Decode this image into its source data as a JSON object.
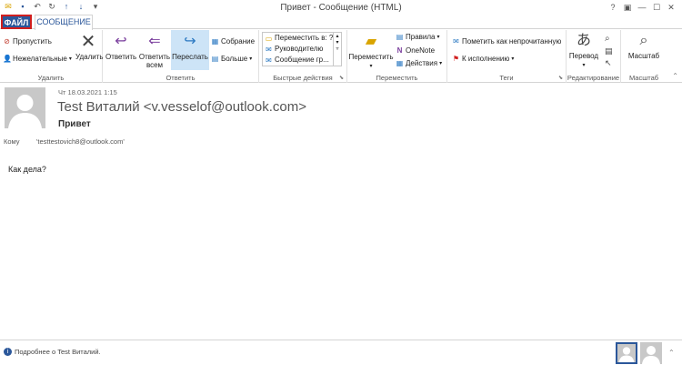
{
  "window": {
    "title": "Привет - Сообщение (HTML)",
    "controls": {
      "help": "?",
      "restore": "▣",
      "minimize": "—",
      "maximize": "☐",
      "close": "✕"
    }
  },
  "quick_access": [
    "save-icon",
    "undo-icon",
    "redo-icon",
    "up-arrow-icon",
    "down-arrow-icon",
    "customize-icon"
  ],
  "tabs": {
    "file": "ФАЙЛ",
    "message": "СООБЩЕНИЕ"
  },
  "ribbon": {
    "delete_group": {
      "label": "Удалить",
      "ignore": "Пропустить",
      "junk": "Нежелательные",
      "delete": "Удалить"
    },
    "respond_group": {
      "label": "Ответить",
      "reply": "Ответить",
      "reply_all_1": "Ответить",
      "reply_all_2": "всем",
      "forward": "Переслать",
      "meeting": "Собрание",
      "more": "Больше"
    },
    "quick_steps_group": {
      "label": "Быстрые действия",
      "items": [
        "Переместить в: ?",
        "Руководителю",
        "Сообщение гр..."
      ]
    },
    "move_group": {
      "label": "Переместить",
      "move": "Переместить",
      "rules": "Правила",
      "onenote": "OneNote",
      "actions": "Действия"
    },
    "tags_group": {
      "label": "Теги",
      "mark_unread": "Пометить как непрочитанную",
      "followup": "К исполнению"
    },
    "editing_group": {
      "label": "Редактирование",
      "translate": "Перевод"
    },
    "zoom_group": {
      "label": "Масштаб",
      "zoom": "Масштаб"
    }
  },
  "message": {
    "date": "Чт 18.03.2021 1:15",
    "sender": "Test Виталий <v.vesselof@outlook.com>",
    "subject": "Привет",
    "to_label": "Кому",
    "to_value": "'testtestovich8@outlook.com'",
    "body": "Как дела?"
  },
  "footer": {
    "info": "Подробнее о Test Виталий."
  }
}
